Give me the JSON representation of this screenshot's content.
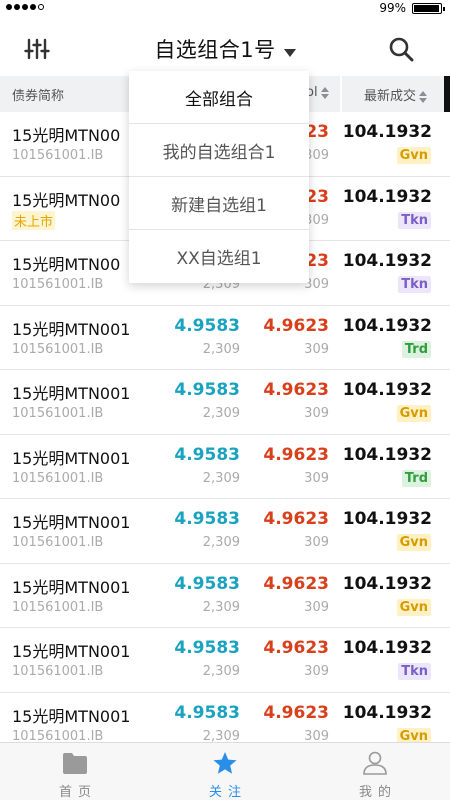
{
  "status_bar": {
    "battery": "99%"
  },
  "nav": {
    "title": "自选组合1号"
  },
  "table_header": {
    "name": "债券简称",
    "vol_partial": "ol",
    "last": "最新成交"
  },
  "dropdown": {
    "items": [
      "全部组合",
      "我的自选组合1",
      "新建自选组1",
      "XX自选组1"
    ]
  },
  "rows": [
    {
      "name": "15光明MTN00",
      "code": "101561001.IB",
      "bid": "",
      "bid_vol": "",
      "ask": "623",
      "ask_vol": "309",
      "last": "104.1932",
      "badge": "Gvn"
    },
    {
      "name": "15光明MTN00",
      "code": "",
      "unlisted": "未上市",
      "bid": "",
      "bid_vol": "",
      "ask": "623",
      "ask_vol": "309",
      "last": "104.1932",
      "badge": "Tkn"
    },
    {
      "name": "15光明MTN00",
      "code": "101561001.IB",
      "bid": "",
      "bid_vol": "2,309",
      "ask": "623",
      "ask_vol": "309",
      "last": "104.1932",
      "badge": "Tkn"
    },
    {
      "name": "15光明MTN001",
      "code": "101561001.IB",
      "bid": "4.9583",
      "bid_vol": "2,309",
      "ask": "4.9623",
      "ask_vol": "309",
      "last": "104.1932",
      "badge": "Trd"
    },
    {
      "name": "15光明MTN001",
      "code": "101561001.IB",
      "bid": "4.9583",
      "bid_vol": "2,309",
      "ask": "4.9623",
      "ask_vol": "309",
      "last": "104.1932",
      "badge": "Gvn"
    },
    {
      "name": "15光明MTN001",
      "code": "101561001.IB",
      "bid": "4.9583",
      "bid_vol": "2,309",
      "ask": "4.9623",
      "ask_vol": "309",
      "last": "104.1932",
      "badge": "Trd"
    },
    {
      "name": "15光明MTN001",
      "code": "101561001.IB",
      "bid": "4.9583",
      "bid_vol": "2,309",
      "ask": "4.9623",
      "ask_vol": "309",
      "last": "104.1932",
      "badge": "Gvn"
    },
    {
      "name": "15光明MTN001",
      "code": "101561001.IB",
      "bid": "4.9583",
      "bid_vol": "2,309",
      "ask": "4.9623",
      "ask_vol": "309",
      "last": "104.1932",
      "badge": "Gvn"
    },
    {
      "name": "15光明MTN001",
      "code": "101561001.IB",
      "bid": "4.9583",
      "bid_vol": "2,309",
      "ask": "4.9623",
      "ask_vol": "309",
      "last": "104.1932",
      "badge": "Tkn"
    },
    {
      "name": "15光明MTN001",
      "code": "101561001.IB",
      "bid": "4.9583",
      "bid_vol": "2,309",
      "ask": "4.9623",
      "ask_vol": "309",
      "last": "104.1932",
      "badge": "Gvn"
    }
  ],
  "tabbar": {
    "items": [
      {
        "label": "首页",
        "icon": "folder-icon"
      },
      {
        "label": "关注",
        "icon": "star-icon"
      },
      {
        "label": "我的",
        "icon": "user-icon"
      }
    ]
  },
  "colors": {
    "bid": "#1aa3c0",
    "ask": "#d8401b",
    "accent": "#2a8ee8"
  }
}
